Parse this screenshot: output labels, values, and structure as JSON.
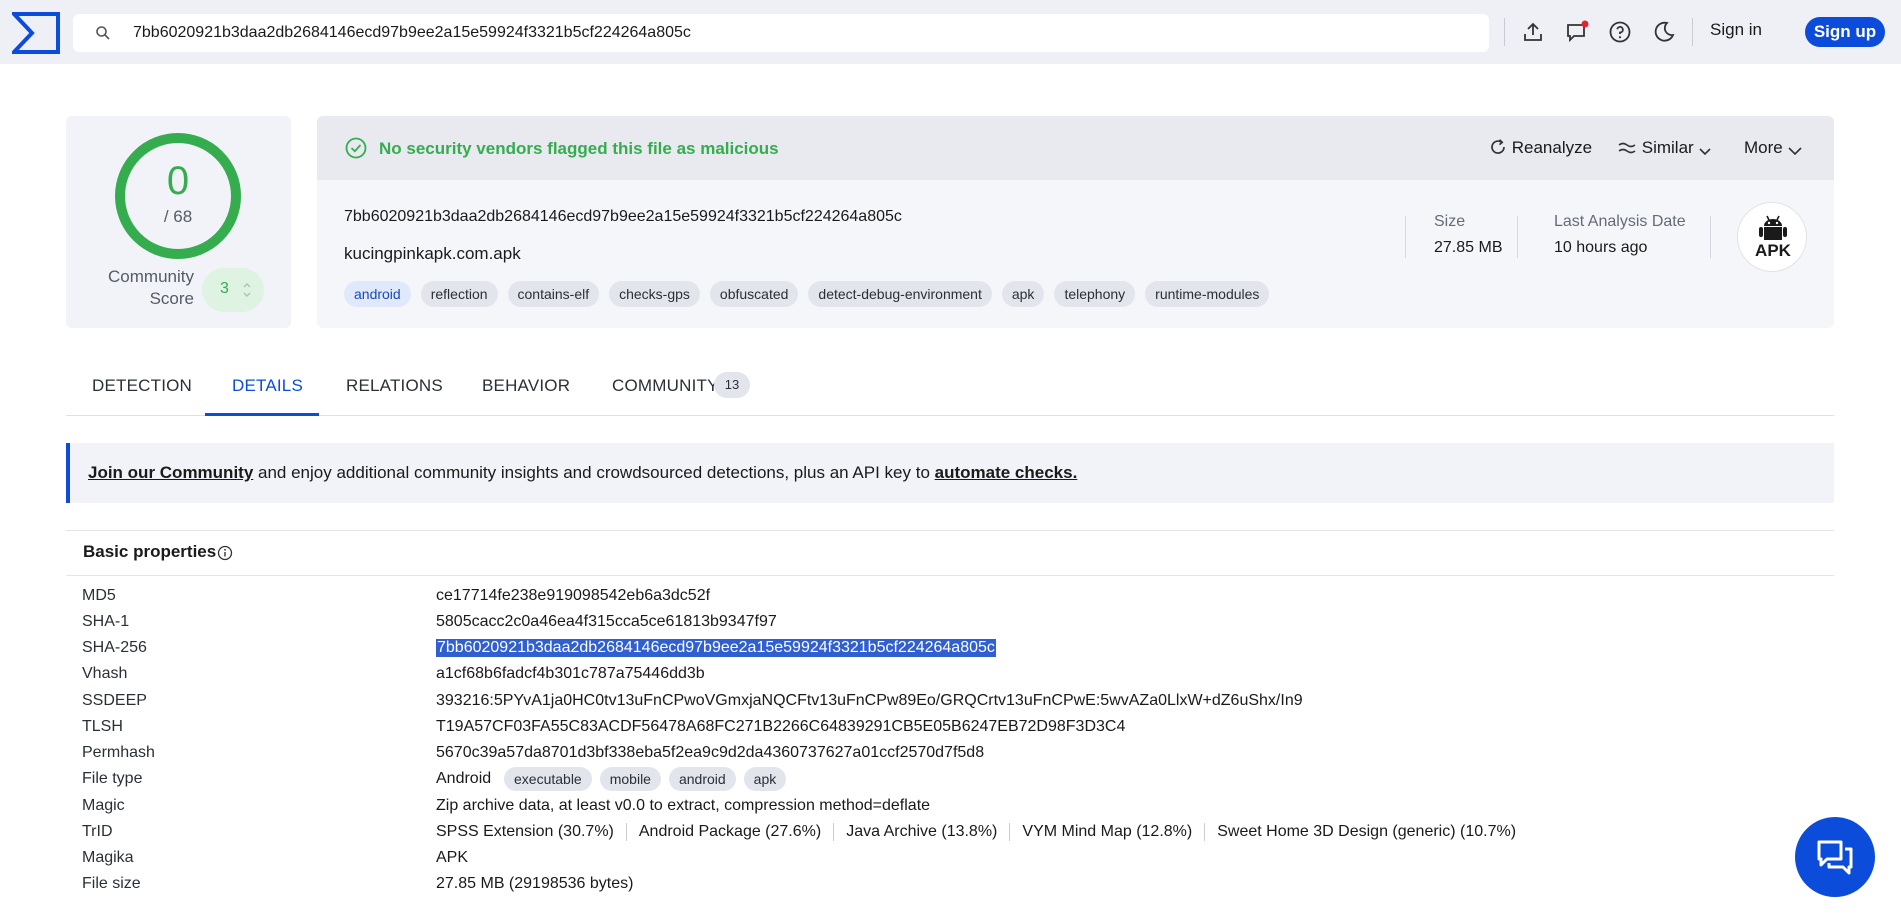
{
  "search": {
    "value": "7bb6020921b3daa2db2684146ecd97b9ee2a15e59924f3321b5cf224264a805c"
  },
  "topbar": {
    "signin_label": "Sign in",
    "signup_label": "Sign up",
    "accent": "#0b4dda"
  },
  "score": {
    "detections": "0",
    "total": "/ 68",
    "community_label": "Community Score",
    "community_value": "3",
    "color": "#35ad4f"
  },
  "banner": {
    "text": "No security vendors flagged this file as malicious",
    "reanalyze": "Reanalyze",
    "similar": "Similar",
    "more": "More"
  },
  "file": {
    "hash": "7bb6020921b3daa2db2684146ecd97b9ee2a15e59924f3321b5cf224264a805c",
    "name": "kucingpinkapk.com.apk",
    "tags": [
      "android",
      "reflection",
      "contains-elf",
      "checks-gps",
      "obfuscated",
      "detect-debug-environment",
      "apk",
      "telephony",
      "runtime-modules"
    ],
    "size_label": "Size",
    "size_value": "27.85 MB",
    "date_label": "Last Analysis Date",
    "date_value": "10 hours ago",
    "type_badge": "APK"
  },
  "tabs": [
    {
      "label": "DETECTION"
    },
    {
      "label": "DETAILS"
    },
    {
      "label": "RELATIONS"
    },
    {
      "label": "BEHAVIOR"
    },
    {
      "label": "COMMUNITY",
      "count": "13"
    }
  ],
  "community_banner": {
    "link1": "Join our Community",
    "middle": " and enjoy additional community insights and crowdsourced detections, plus an API key to ",
    "link2": "automate checks."
  },
  "basic": {
    "title": "Basic properties",
    "rows": [
      {
        "key": "MD5",
        "value": "ce17714fe238e919098542eb6a3dc52f"
      },
      {
        "key": "SHA-1",
        "value": "5805cacc2c0a46ea4f315cca5ce61813b9347f97"
      },
      {
        "key": "SHA-256",
        "value": "7bb6020921b3daa2db2684146ecd97b9ee2a15e59924f3321b5cf224264a805c"
      },
      {
        "key": "Vhash",
        "value": "a1cf68b6fadcf4b301c787a75446dd3b"
      },
      {
        "key": "SSDEEP",
        "value": "393216:5PYvA1ja0HC0tv13uFnCPwoVGmxjaNQCFtv13uFnCPw89Eo/GRQCrtv13uFnCPwE:5wvAZa0LlxW+dZ6uShx/In9"
      },
      {
        "key": "TLSH",
        "value": "T19A57CF03FA55C83ACDF56478A68FC271B2266C64839291CB5E05B6247EB72D98F3D3C4"
      },
      {
        "key": "Permhash",
        "value": "5670c39a57da8701d3bf338eba5f2ea9c9d2da4360737627a01ccf2570d7f5d8"
      },
      {
        "key": "File type",
        "value": "Android",
        "tags": [
          "executable",
          "mobile",
          "android",
          "apk"
        ]
      },
      {
        "key": "Magic",
        "value": "Zip archive data, at least v0.0 to extract, compression method=deflate"
      },
      {
        "key": "TrID",
        "items": [
          "SPSS Extension (30.7%)",
          "Android Package (27.6%)",
          "Java Archive (13.8%)",
          "VYM Mind Map (12.8%)",
          "Sweet Home 3D Design (generic) (10.7%)"
        ]
      },
      {
        "key": "Magika",
        "value": "APK"
      },
      {
        "key": "File size",
        "value": "27.85 MB (29198536 bytes)"
      }
    ]
  }
}
